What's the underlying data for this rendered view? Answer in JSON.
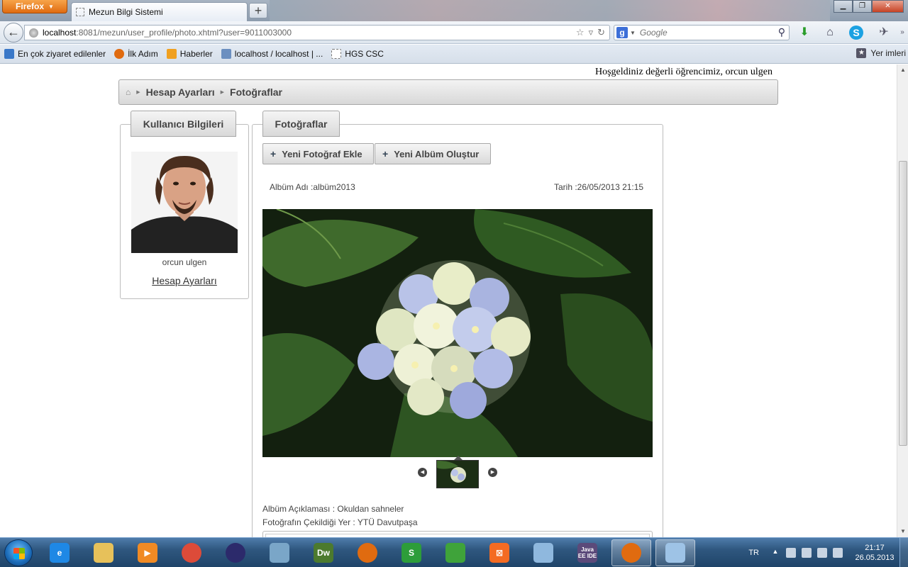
{
  "browser": {
    "menu_label": "Firefox",
    "tab_title": "Mezun Bilgi Sistemi",
    "new_tab_label": "+",
    "url_host": "localhost",
    "url_path": ":8081/mezun/user_profile/photo.xhtml?user=9011003000",
    "search_engine_letter": "g",
    "search_placeholder": "Google",
    "bookmarks": [
      {
        "label": "En çok ziyaret edilenler",
        "icon": "most-visited-icon",
        "color": "#3a78c8"
      },
      {
        "label": "İlk Adım",
        "icon": "firefox-icon",
        "color": "#e06b10"
      },
      {
        "label": "Haberler",
        "icon": "rss-icon",
        "color": "#f0a020"
      },
      {
        "label": "localhost / localhost | ...",
        "icon": "phpmyadmin-icon",
        "color": "#6b8fc0"
      },
      {
        "label": "HGS CSC",
        "icon": "blank-page-icon",
        "color": "#ffffff"
      }
    ],
    "bookmarks_menu_label": "Yer imleri"
  },
  "page": {
    "welcome": "Hoşgeldiniz değerli öğrencimiz, orcun ulgen",
    "breadcrumb": [
      "Hesap Ayarları",
      "Fotoğraflar"
    ],
    "user_panel_title": "Kullanıcı Bilgileri",
    "user_name": "orcun ulgen",
    "account_link": "Hesap Ayarları",
    "photos_panel_title": "Fotoğraflar",
    "add_photo_button": "Yeni Fotoğraf Ekle",
    "new_album_button": "Yeni Albüm Oluştur",
    "album_name": "Albüm Adı :albüm2013",
    "album_date": "Tarih :26/05/2013 21:15",
    "album_description": "Albüm Açıklaması : Okuldan sahneler",
    "photo_location": "Fotoğrafın Çekildiği Yer : YTÜ Davutpaşa"
  },
  "taskbar": {
    "apps": [
      {
        "name": "ie-icon",
        "color": "#1e88e5",
        "letter": "e"
      },
      {
        "name": "explorer-folder-icon",
        "color": "#e7c15a",
        "letter": ""
      },
      {
        "name": "media-player-icon",
        "color": "#f08a24",
        "letter": "▶"
      },
      {
        "name": "chrome-icon",
        "color": "#dd4b39",
        "letter": ""
      },
      {
        "name": "eclipse-icon",
        "color": "#2c2a6b",
        "letter": ""
      },
      {
        "name": "database-icon",
        "color": "#7aa6c8",
        "letter": ""
      },
      {
        "name": "dreamweaver-icon",
        "color": "#4c7a2e",
        "letter": "Dw"
      },
      {
        "name": "firefox-icon",
        "color": "#e06b10",
        "letter": ""
      },
      {
        "name": "s-app-icon",
        "color": "#2d9d3a",
        "letter": "S"
      },
      {
        "name": "leaf-app-icon",
        "color": "#3fa33a",
        "letter": ""
      },
      {
        "name": "xampp-icon",
        "color": "#f46b22",
        "letter": "⊠"
      },
      {
        "name": "virtual-box-icon",
        "color": "#8fb8de",
        "letter": ""
      },
      {
        "name": "java-ee-ide-icon",
        "color": "#5b4a7a",
        "letter": "Java EE IDE"
      },
      {
        "name": "firefox-active-icon",
        "color": "#e06b10",
        "letter": ""
      },
      {
        "name": "paint-icon",
        "color": "#9ec3e6",
        "letter": ""
      }
    ],
    "language": "TR",
    "time": "21:17",
    "date": "26.05.2013"
  }
}
